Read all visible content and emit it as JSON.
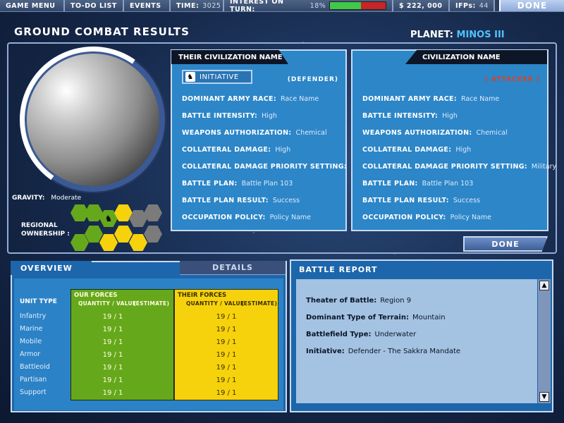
{
  "topbar": {
    "game_menu": "GAME MENU",
    "todo": "TO-DO LIST",
    "events": "EVENTS",
    "time_label": "TIME:",
    "time_value": "3025",
    "interest_label": "INTEREST ON TURN:",
    "interest_value": "18%",
    "interest_fraction": 0.55,
    "money": "$ 222, 000",
    "ifps_label": "IFPs:",
    "ifps_value": "44",
    "done": "DONE"
  },
  "title": "GROUND COMBAT RESULTS",
  "planet": {
    "label": "PLANET:",
    "name": "MINOS III"
  },
  "gravity": {
    "label": "GRAVITY:",
    "value": "Moderate"
  },
  "regional": {
    "line1": "REGIONAL",
    "line2": "OWNERSHIP :"
  },
  "hex_colors": {
    "green": "#66a81b",
    "yellow": "#f6d20c",
    "gray": "#7b7b7b"
  },
  "defender": {
    "header": "THEIR CIVILIZATION NAME",
    "initiative_label": "INITIATIVE",
    "role": "(DEFENDER)",
    "rows": [
      {
        "label": "DOMINANT ARMY RACE:",
        "value": "Race Name"
      },
      {
        "label": "BATTLE INTENSITY:",
        "value": "High"
      },
      {
        "label": "WEAPONS AUTHORIZATION:",
        "value": "Chemical"
      },
      {
        "label": "COLLATERAL DAMAGE:",
        "value": "High"
      },
      {
        "label": "COLLATERAL DAMAGE PRIORITY SETTING:",
        "value": "Military"
      },
      {
        "label": "BATTLE PLAN:",
        "value": "Battle Plan 103"
      },
      {
        "label": "BATTLE PLAN RESULT:",
        "value": "Success"
      },
      {
        "label": "OCCUPATION POLICY:",
        "value": "Policy Name"
      }
    ]
  },
  "attacker": {
    "header": "CIVILIZATION NAME",
    "role": "( ATTACKER )",
    "role_color": "#e04020",
    "rows": [
      {
        "label": "DOMINANT ARMY RACE:",
        "value": "Race Name"
      },
      {
        "label": "BATTLE INTENSITY:",
        "value": "High"
      },
      {
        "label": "WEAPONS AUTHORIZATION:",
        "value": "Chemical"
      },
      {
        "label": "COLLATERAL DAMAGE:",
        "value": "High"
      },
      {
        "label": "COLLATERAL DAMAGE PRIORITY SETTING:",
        "value": "Military"
      },
      {
        "label": "BATTLE PLAN:",
        "value": "Battle Plan 103"
      },
      {
        "label": "BATTLE PLAN RESULT:",
        "value": "Success"
      },
      {
        "label": "OCCUPATION POLICY:",
        "value": "Policy Name"
      }
    ]
  },
  "done_button": "DONE",
  "tabs": {
    "overview": "OVERVIEW",
    "details": "DETAILS"
  },
  "overview": {
    "unit_type_header": "UNIT TYPE",
    "our_forces": "OUR FORCES",
    "their_forces": "THEIR FORCES",
    "qv_header": "QUANTITY / VALUE",
    "estimate": "(ESTIMATE)",
    "units": [
      {
        "name": "Infantry",
        "ours": "19 / 1",
        "theirs": "19 / 1"
      },
      {
        "name": "Marine",
        "ours": "19 / 1",
        "theirs": "19 / 1"
      },
      {
        "name": "Mobile",
        "ours": "19 / 1",
        "theirs": "19 / 1"
      },
      {
        "name": "Armor",
        "ours": "19 / 1",
        "theirs": "19 / 1"
      },
      {
        "name": "Battleoid",
        "ours": "19 / 1",
        "theirs": "19 / 1"
      },
      {
        "name": "Partisan",
        "ours": "19 / 1",
        "theirs": "19 / 1"
      },
      {
        "name": "Support",
        "ours": "19 / 1",
        "theirs": "19 / 1"
      }
    ]
  },
  "report": {
    "title": "BATTLE REPORT",
    "rows": [
      {
        "label": "Theater of Battle:",
        "value": "Region 9"
      },
      {
        "label": "Dominant Type of Terrain:",
        "value": "Mountain"
      },
      {
        "label": "Battlefield Type:",
        "value": "Underwater"
      },
      {
        "label": "Initiative:",
        "value": "Defender  -  The Sakkra Mandate"
      }
    ]
  }
}
